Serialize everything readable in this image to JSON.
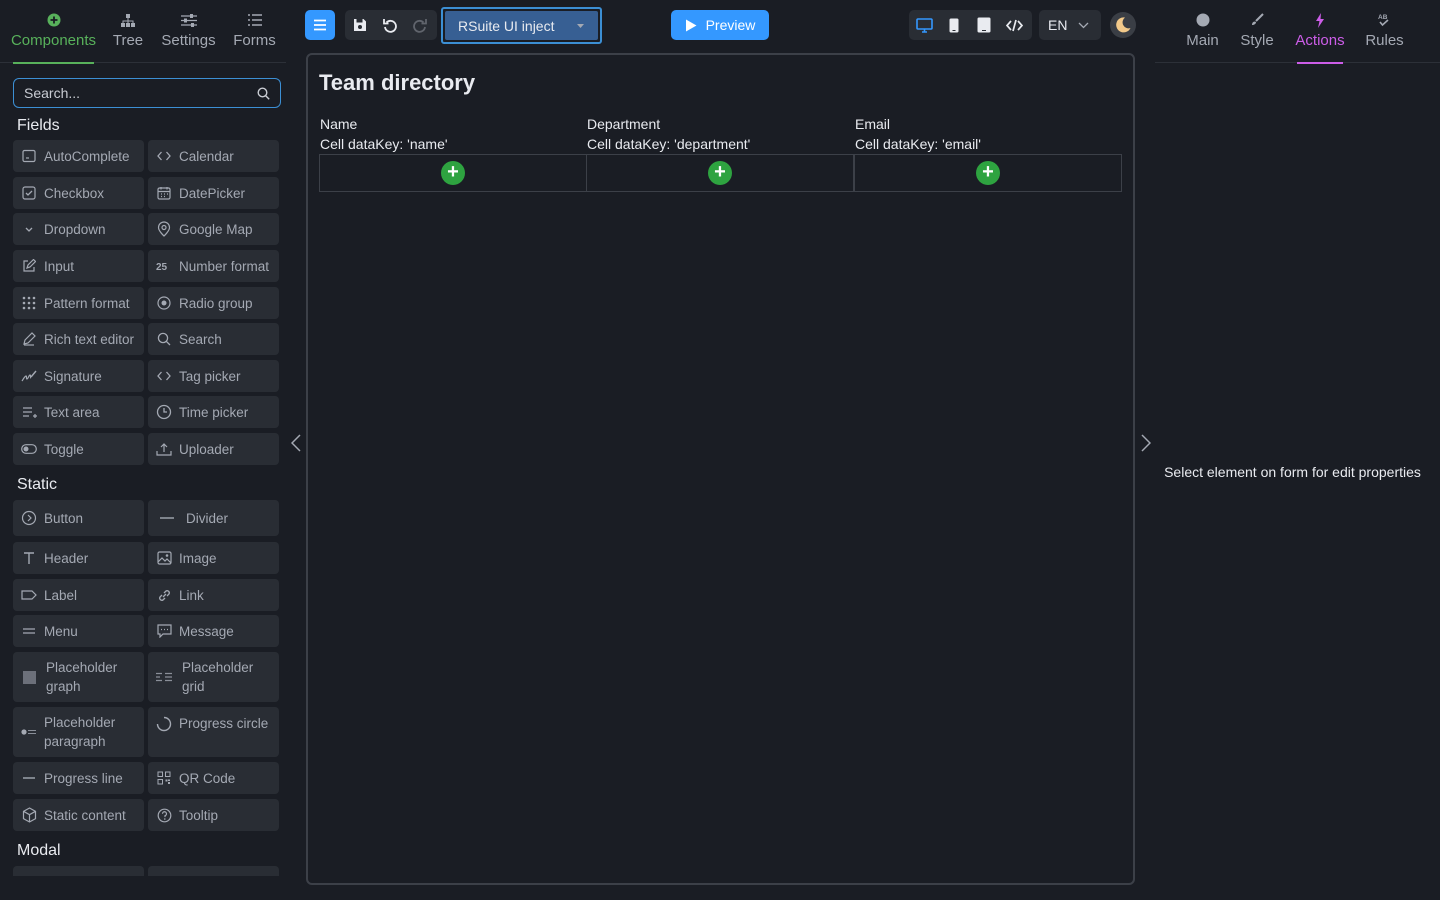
{
  "left_tabs": [
    {
      "label": "Components",
      "icon": "plus-circle-icon",
      "active": true
    },
    {
      "label": "Tree",
      "icon": "tree-icon",
      "active": false
    },
    {
      "label": "Settings",
      "icon": "sliders-icon",
      "active": false
    },
    {
      "label": "Forms",
      "icon": "list-icon",
      "active": false
    }
  ],
  "search": {
    "placeholder": "Search..."
  },
  "sections": {
    "fields": "Fields",
    "static": "Static",
    "modal": "Modal"
  },
  "fields": [
    "AutoComplete",
    "Calendar",
    "Checkbox",
    "DatePicker",
    "Dropdown",
    "Google Map",
    "Input",
    "Number format",
    "Pattern format",
    "Radio group",
    "Rich text editor",
    "Search",
    "Signature",
    "Tag picker",
    "Text area",
    "Time picker",
    "Toggle",
    "Uploader"
  ],
  "static": [
    "Button",
    "Divider",
    "Header",
    "Image",
    "Label",
    "Link",
    "Menu",
    "Message",
    "Placeholder graph",
    "Placeholder grid",
    "Placeholder paragraph",
    "Progress circle",
    "Progress line",
    "QR Code",
    "Static content",
    "Tooltip"
  ],
  "toolbar": {
    "form_name": "RSuite UI inject",
    "preview_label": "Preview",
    "language": "EN"
  },
  "canvas": {
    "title": "Team directory",
    "columns": [
      {
        "header": "Name",
        "datakey": "Cell dataKey: 'name'"
      },
      {
        "header": "Department",
        "datakey": "Cell dataKey: 'department'"
      },
      {
        "header": "Email",
        "datakey": "Cell dataKey: 'email'"
      }
    ]
  },
  "right_tabs": [
    {
      "label": "Main",
      "icon": "circle-icon",
      "active": false
    },
    {
      "label": "Style",
      "icon": "brush-icon",
      "active": false
    },
    {
      "label": "Actions",
      "icon": "lightning-icon",
      "active": true
    },
    {
      "label": "Rules",
      "icon": "rules-icon",
      "active": false
    }
  ],
  "right_panel": {
    "empty_message": "Select element on form for edit properties"
  },
  "colors": {
    "background": "#1a1d24",
    "accent_blue": "#3498ff",
    "components_green": "#58b15b",
    "actions_purple": "#cc5de8",
    "add_green": "#2ea340"
  }
}
